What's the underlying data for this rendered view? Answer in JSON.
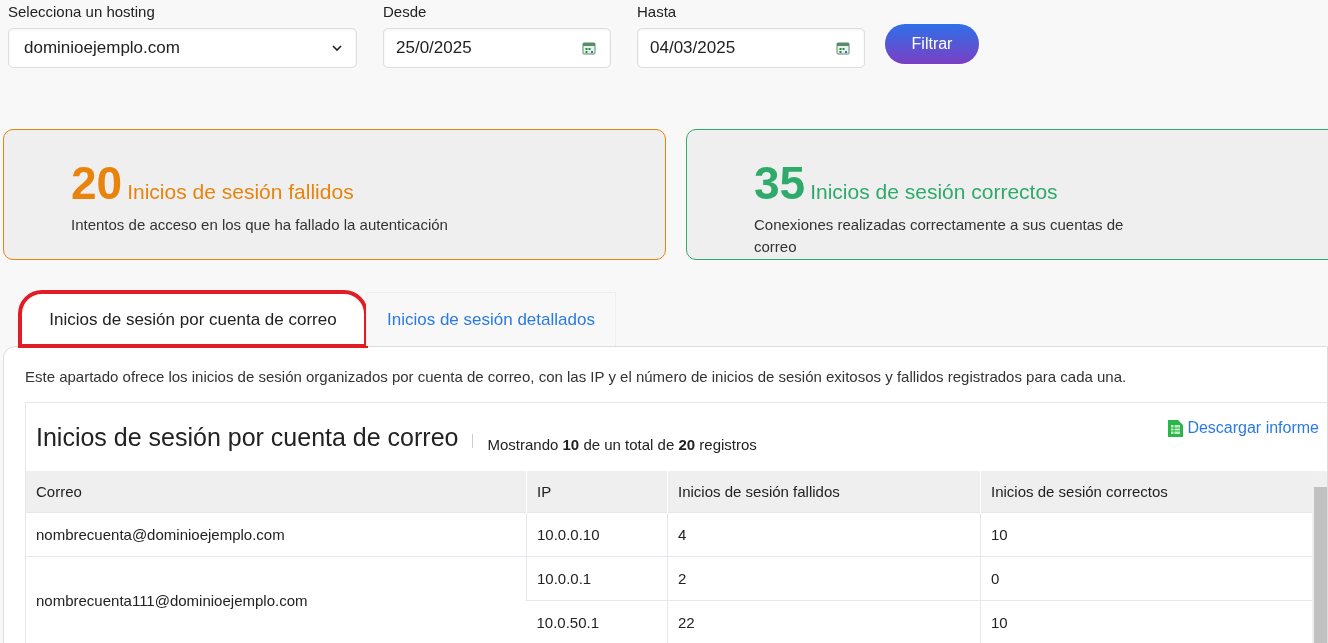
{
  "filters": {
    "hosting": {
      "label": "Selecciona un hosting",
      "value": "dominioejemplo.com"
    },
    "from": {
      "label": "Desde",
      "value": "25/0/2025"
    },
    "to": {
      "label": "Hasta",
      "value": "04/03/2025"
    },
    "button": "Filtrar"
  },
  "stats": [
    {
      "kind": "failed",
      "count": "20",
      "title": "Inicios de sesión fallidos",
      "description": "Intentos de acceso en los que ha fallado la autenticación",
      "color": "#e8830c"
    },
    {
      "kind": "success",
      "count": "35",
      "title": "Inicios de sesión correctos",
      "description": "Conexiones realizadas correctamente a sus cuentas de correo",
      "color": "#2eaa6a"
    }
  ],
  "tabs": [
    {
      "label": "Inicios de sesión por cuenta de correo",
      "selected": true,
      "highlighted": true
    },
    {
      "label": "Inicios de sesión detallados",
      "selected": false,
      "highlighted": false
    }
  ],
  "panel": {
    "description": "Este apartado ofrece los inicios de sesión organizados por cuenta de correo, con las IP y el número de inicios de sesión exitosos y fallidos registrados para cada una.",
    "table_title": "Inicios de sesión por cuenta de correo",
    "summary": "Mostrando **10** de un total de **20** registros",
    "download": "Descargar informe",
    "columns": [
      "Correo",
      "IP",
      "Inicios de sesión fallidos",
      "Inicios de sesión correctos"
    ],
    "rows": [
      {
        "account": "nombrecuenta@dominioejemplo.com",
        "ips": [
          {
            "ip": "10.0.0.10",
            "failed": "4",
            "success": "10"
          }
        ]
      },
      {
        "account": "nombrecuenta111@dominioejemplo.com",
        "ips": [
          {
            "ip": "10.0.0.1",
            "failed": "2",
            "success": "0"
          },
          {
            "ip": "10.0.50.1",
            "failed": "22",
            "success": "10"
          }
        ]
      }
    ]
  }
}
